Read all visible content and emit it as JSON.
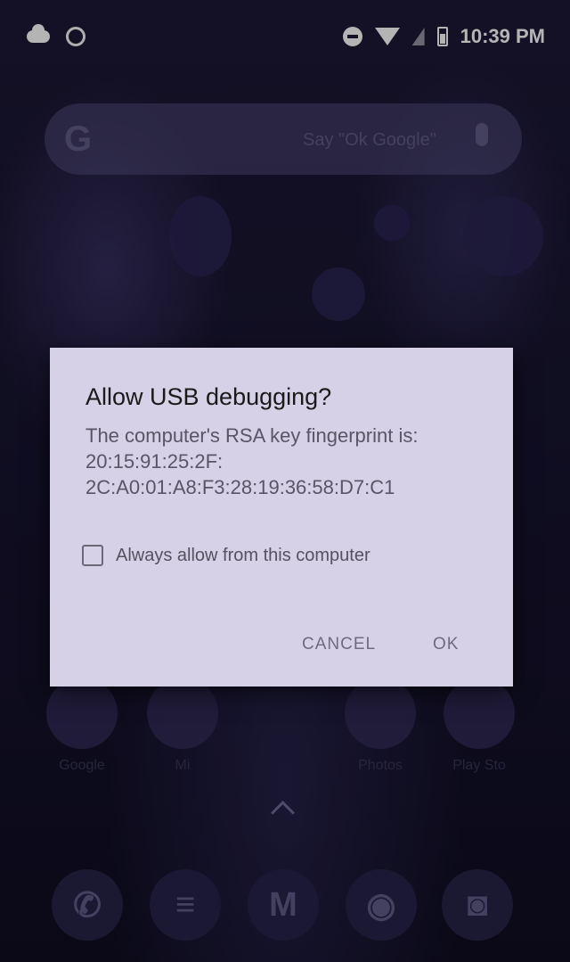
{
  "status_bar": {
    "time": "10:39 PM",
    "icons": [
      "cloud-icon",
      "shield-icon",
      "do-not-disturb-icon",
      "wifi-icon",
      "cell-signal-icon",
      "battery-icon"
    ]
  },
  "search_bar": {
    "logo": "G",
    "hint": "Say \"Ok Google\"",
    "icons": [
      "google-logo-icon",
      "mic-icon"
    ]
  },
  "dialog": {
    "title": "Allow USB debugging?",
    "message": "The computer's RSA key fingerprint is:",
    "fingerprint_line1": "20:15:91:25:2F:",
    "fingerprint_line2": "2C:A0:01:A8:F3:28:19:36:58:D7:C1",
    "checkbox_label": "Always allow from this computer",
    "checkbox_checked": false,
    "cancel_label": "CANCEL",
    "ok_label": "OK",
    "background_color": "#d6d1e6"
  },
  "home_apps": [
    {
      "label": "Google",
      "icon": "google-folder-icon"
    },
    {
      "label": "Mi",
      "icon": "mi-icon"
    },
    {
      "label": "Photos",
      "icon": "photos-icon"
    },
    {
      "label": "Play Sto",
      "icon": "play-store-icon"
    }
  ],
  "dock": [
    "phone-icon",
    "messages-icon",
    "gmail-icon",
    "chrome-icon",
    "camera-icon"
  ]
}
